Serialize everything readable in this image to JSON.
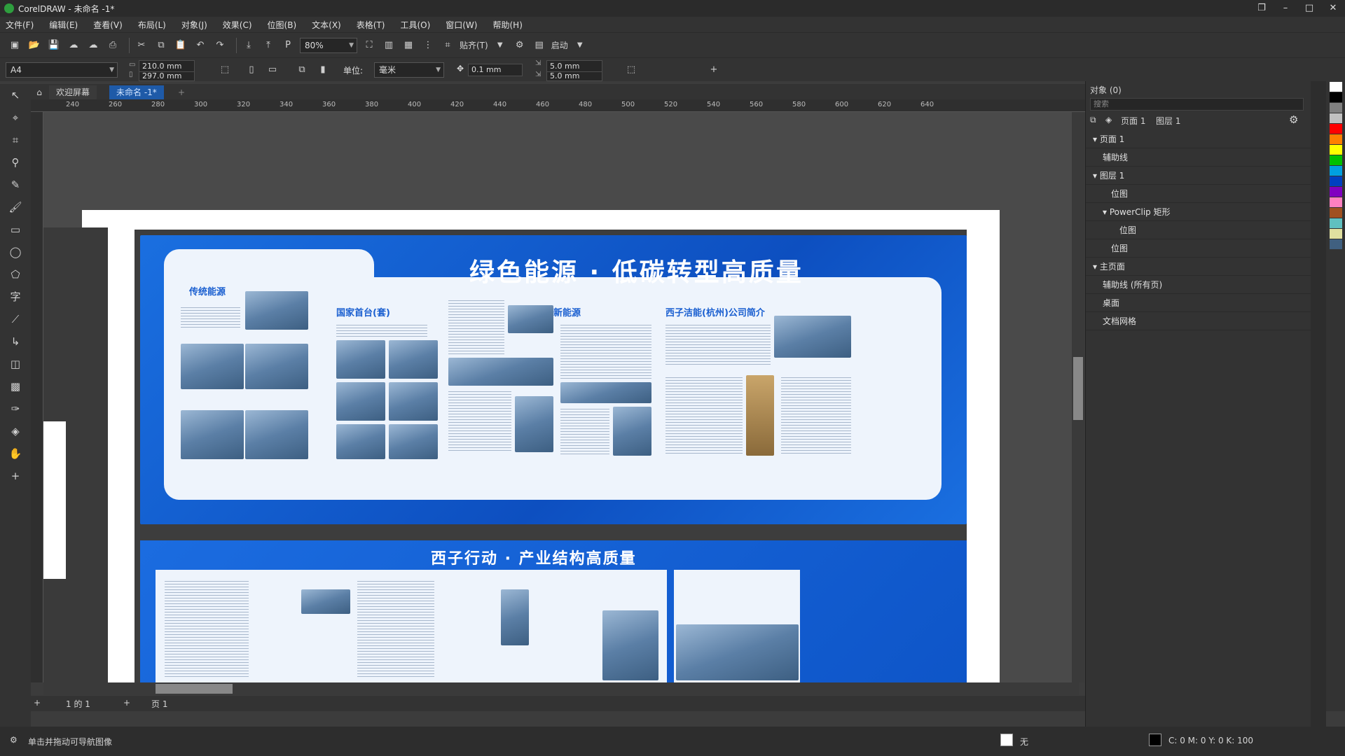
{
  "window": {
    "title": "CorelDRAW - 未命名 -1*"
  },
  "menu": [
    "文件(F)",
    "编辑(E)",
    "查看(V)",
    "布局(L)",
    "对象(J)",
    "效果(C)",
    "位图(B)",
    "文本(X)",
    "表格(T)",
    "工具(O)",
    "窗口(W)",
    "帮助(H)"
  ],
  "toolbar": {
    "zoom": "80%",
    "snap_label": "贴齐(T)",
    "launch_label": "启动"
  },
  "property_bar": {
    "page_size": "A4",
    "width": "210.0 mm",
    "height": "297.0 mm",
    "unit_label": "单位:",
    "unit_value": "毫米",
    "nudge": "0.1 mm",
    "dup_x": "5.0 mm",
    "dup_y": "5.0 mm"
  },
  "tabs": {
    "welcome": "欢迎屏幕",
    "doc": "未命名 -1*"
  },
  "ruler": {
    "h_ticks": [
      "240",
      "260",
      "280",
      "300",
      "320",
      "340",
      "360",
      "380",
      "400",
      "420",
      "440",
      "460",
      "480",
      "500",
      "520",
      "540",
      "560",
      "580",
      "600",
      "620",
      "640"
    ]
  },
  "artwork": {
    "headline1": "绿色能源 · 低碳转型高质量",
    "headline2": "西子行动 · 产业结构高质量",
    "sections": [
      "传统能源",
      "国家首台(套)",
      "新能源",
      "西子洁能(杭州)公司简介"
    ]
  },
  "objects_panel": {
    "title": "对象 (0)",
    "search_placeholder": "搜索",
    "page_label": "页面 1",
    "layer_label": "图层 1",
    "tree": [
      {
        "label": "页面 1",
        "level": 0
      },
      {
        "label": "辅助线",
        "level": 1
      },
      {
        "label": "图层 1",
        "level": 1
      },
      {
        "label": "位图",
        "level": 2
      },
      {
        "label": "PowerClip 矩形",
        "level": 2
      },
      {
        "label": "位图",
        "level": 3
      },
      {
        "label": "位图",
        "level": 2
      },
      {
        "label": "主页面",
        "level": 0
      },
      {
        "label": "辅助线 (所有页)",
        "level": 1
      },
      {
        "label": "桌面",
        "level": 1
      },
      {
        "label": "文档网格",
        "level": 1
      }
    ]
  },
  "page_nav": {
    "count": "1 的 1",
    "page_tab": "页 1"
  },
  "status": {
    "hint": "单击并拖动可导航图像",
    "fill": "无",
    "color": "C: 0 M: 0 Y: 0 K: 100"
  },
  "palette_colors": [
    "#ffffff",
    "#000000",
    "#7f7f7f",
    "#c0c0c0",
    "#ff0000",
    "#ff7f00",
    "#ffff00",
    "#00c000",
    "#00a0e0",
    "#0040c0",
    "#8000c0",
    "#ff80c0",
    "#a05020",
    "#60c0c0",
    "#e0e0a0",
    "#406080"
  ]
}
